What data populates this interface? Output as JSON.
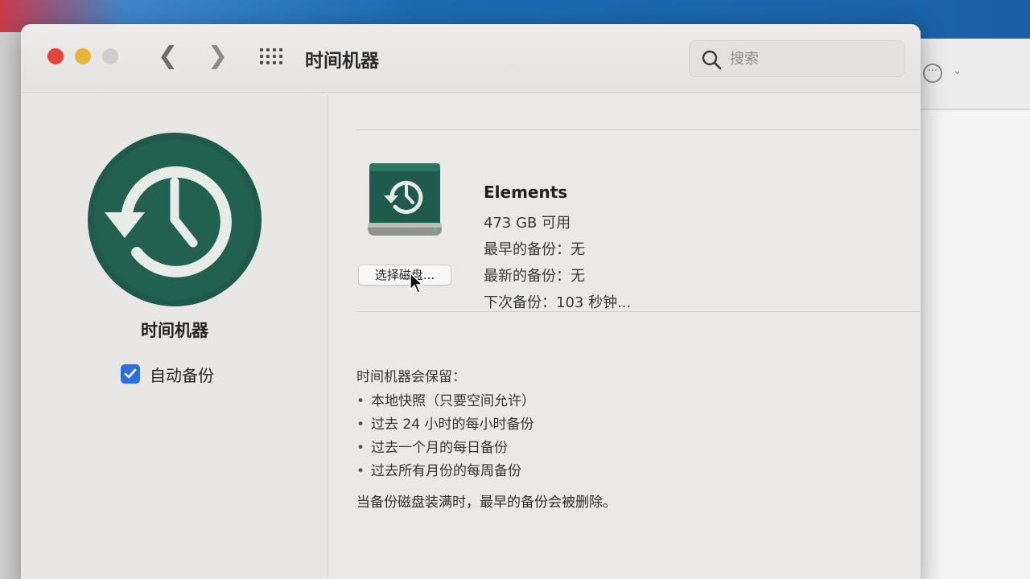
{
  "window": {
    "title": "时间机器"
  },
  "search": {
    "placeholder": "搜索"
  },
  "sidebar": {
    "title": "时间机器",
    "auto_backup_label": "自动备份",
    "auto_backup_checked": true
  },
  "disk": {
    "name": "Elements",
    "available": "473 GB 可用",
    "oldest_backup": "最早的备份：无",
    "latest_backup": "最新的备份：无",
    "next_backup": "下次备份：103 秒钟...",
    "select_button_label": "选择磁盘..."
  },
  "keeps": {
    "title": "时间机器会保留：",
    "items": [
      "本地快照（只要空间允许）",
      "过去 24 小时的每小时备份",
      "过去一个月的每日备份",
      "过去所有月份的每周备份"
    ],
    "note": "当备份磁盘装满时，最早的备份会被删除。"
  },
  "colors": {
    "accent_blue": "#2c6fe0",
    "time_machine_green": "#1f5a4d",
    "close": "#e4443b",
    "minimize": "#e9b43a"
  },
  "icons": {
    "back": "chevron-left-icon",
    "forward": "chevron-right-icon",
    "grid": "grid-icon",
    "search": "search-icon",
    "time_machine": "time-machine-icon",
    "disk": "backup-disk-icon"
  }
}
